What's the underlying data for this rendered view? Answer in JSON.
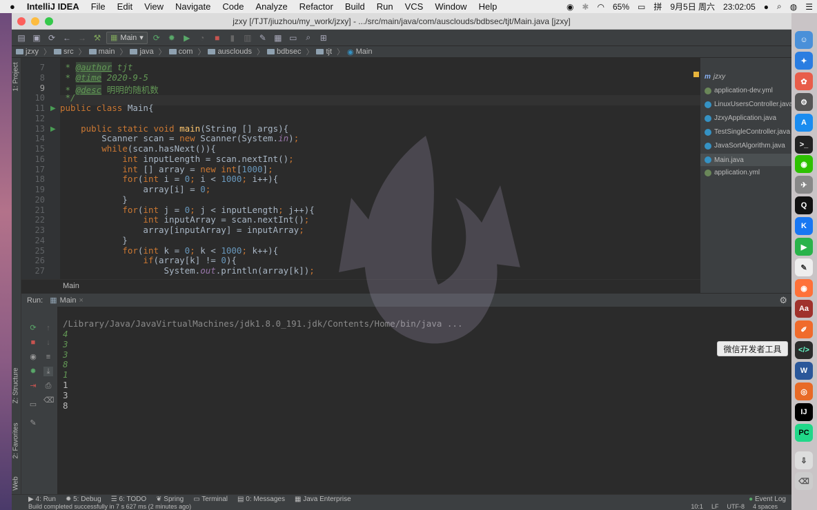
{
  "menubar": {
    "apple": "",
    "app": "IntelliJ IDEA",
    "items": [
      "File",
      "Edit",
      "View",
      "Navigate",
      "Code",
      "Analyze",
      "Refactor",
      "Build",
      "Run",
      "VCS",
      "Window",
      "Help"
    ],
    "battery": "65%",
    "date": "9月5日 周六",
    "time": "23:02:05"
  },
  "window": {
    "title": "jzxy [/TJT/jiuzhou/my_work/jzxy] - .../src/main/java/com/ausclouds/bdbsec/tjt/Main.java [jzxy]"
  },
  "toolbar": {
    "run_config": "Main"
  },
  "breadcrumbs": [
    "jzxy",
    "src",
    "main",
    "java",
    "com",
    "ausclouds",
    "bdbsec",
    "tjt",
    "Main"
  ],
  "left_strip": {
    "project": "1: Project",
    "structure": "Z: Structure",
    "favorites": "2: Favorites",
    "web": "Web"
  },
  "editor": {
    "line_numbers": [
      "7",
      "8",
      "9",
      "10",
      "11",
      "12",
      "13",
      "14",
      "15",
      "16",
      "17",
      "18",
      "19",
      "20",
      "21",
      "22",
      "23",
      "24",
      "25",
      "26",
      "27"
    ],
    "crumb": "Main"
  },
  "recent_files": [
    "jzxy",
    "application-dev.yml",
    "LinuxUsersController.java",
    "JzxyApplication.java",
    "TestSingleController.java",
    "JavaSortAlgorithm.java",
    "Main.java",
    "application.yml"
  ],
  "run": {
    "label": "Run:",
    "tab": "Main",
    "cmd": "/Library/Java/JavaVirtualMachines/jdk1.8.0_191.jdk/Contents/Home/bin/java ...",
    "input": [
      "4",
      "3",
      "3",
      "8",
      "1"
    ],
    "output": [
      "1",
      "3",
      "8"
    ]
  },
  "bottom_tabs": [
    "4: Run",
    "5: Debug",
    "6: TODO",
    "Spring",
    "Terminal",
    "0: Messages",
    "Java Enterprise"
  ],
  "event_log": "Event Log",
  "status": {
    "message": "Build completed successfully in 7 s 627 ms (2 minutes ago)",
    "position": "10:1",
    "lf": "LF",
    "encoding": "UTF-8",
    "indent": "4 spaces"
  },
  "tooltip": "微信开发者工具",
  "colors": {
    "editor_bg": "#2b2b2b",
    "panel_bg": "#3c3f41",
    "keyword": "#cc7832",
    "number": "#6897bb",
    "doc": "#629755",
    "input_green": "#629755"
  }
}
